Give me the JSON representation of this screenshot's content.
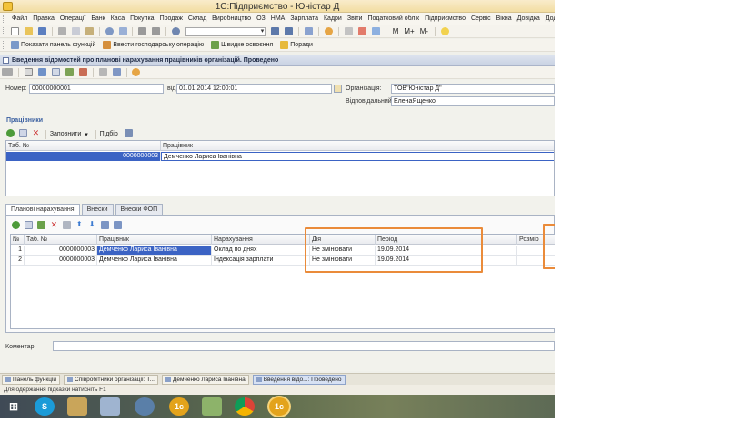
{
  "window": {
    "title": "1С:Підприємство - Юністар Д"
  },
  "menu": [
    "Файл",
    "Правка",
    "Операції",
    "Банк",
    "Каса",
    "Покупка",
    "Продаж",
    "Склад",
    "Виробництво",
    "ОЗ",
    "НМА",
    "Зарплата",
    "Кадри",
    "Звіти",
    "Податковий облік",
    "Підприємство",
    "Сервіс",
    "Вікна",
    "Довідка",
    "Додаткові з"
  ],
  "toolbar1": {
    "memory_labels": [
      "M",
      "M+",
      "M-"
    ]
  },
  "toolbar2": {
    "show_panel": "Показати панель функцій",
    "enter_operation": "Ввести господарську операцію",
    "quick_learning": "Швидке освоєння",
    "tips": "Поради"
  },
  "document": {
    "title": "Введення відомостей про планові нарахування працівників організацій. Проведено",
    "number_label": "Номер:",
    "number": "00000000001",
    "date_label": "від:",
    "date": "01.01.2014 12:00:01",
    "org_label": "Організація:",
    "org": "ТОВ\"Юністар Д\"",
    "responsible_label": "Відповідальний:",
    "responsible": "ЕленаЯщенко",
    "comment_label": "Коментар:",
    "comment": ""
  },
  "employees": {
    "section_title": "Працівники",
    "fill_label": "Заповнити",
    "select_label": "Підбір",
    "columns": [
      "Таб. №",
      "Працівник"
    ],
    "rows": [
      {
        "tab": "0000000003",
        "name": "Демченко Лариса Іванівна"
      }
    ]
  },
  "tabs": [
    "Планові нарахування",
    "Внески",
    "Внески ФОП"
  ],
  "accruals": {
    "columns": [
      "№",
      "Таб. №",
      "Працівник",
      "Нарахування",
      "Дія",
      "Період",
      "",
      "Розмір"
    ],
    "rows": [
      {
        "n": "1",
        "tab": "0000000003",
        "employee": "Демченко Лариса Іванівна",
        "accrual": "Оклад по днях",
        "action": "Не змінювати",
        "period": "19.09.2014"
      },
      {
        "n": "2",
        "tab": "0000000003",
        "employee": "Демченко Лариса Іванівна",
        "accrual": "Індексація зарплати",
        "action": "Не змінювати",
        "period": "19.09.2014"
      }
    ]
  },
  "window_tabs": [
    "Панель функцій",
    "Співробітники організації: Т...",
    "Демченко Лариса Іванівна",
    "Введення відо...: Проведено"
  ],
  "status": "Для одержання підказки натисніть F1",
  "colors": {
    "highlight": "#ea8b3a",
    "selection": "#3b63c4"
  }
}
